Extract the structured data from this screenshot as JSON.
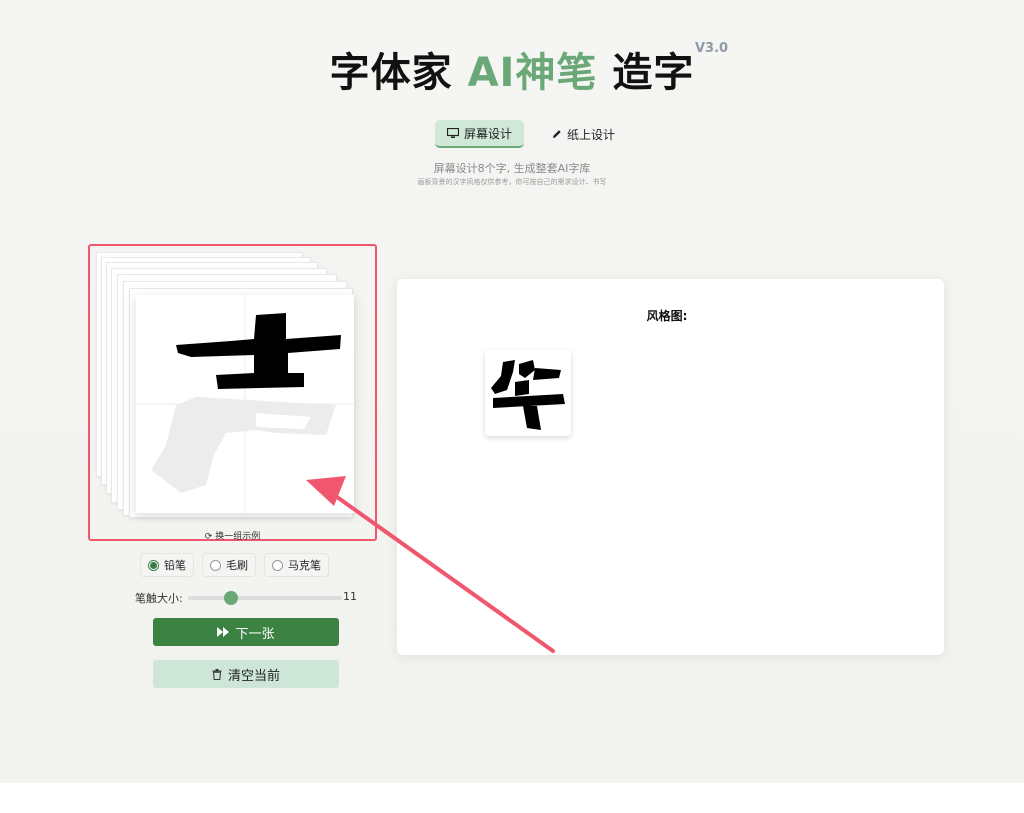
{
  "header": {
    "title_prefix": "字体家",
    "title_accent": "AI神笔",
    "title_suffix": "造字",
    "version": "V3.0"
  },
  "modes": [
    {
      "label": "屏幕设计",
      "icon": "monitor-icon",
      "active": true
    },
    {
      "label": "纸上设计",
      "icon": "pencil-icon",
      "active": false
    }
  ],
  "subtitle": "屏幕设计8个字, 生成整套AI字库",
  "subnote": "画板背景的汉字风格仅供参考，你可按自己的需求设计、书写",
  "canvas": {
    "change_examples_label": "换一组示例",
    "brushes": [
      {
        "label": "铅笔",
        "selected": true
      },
      {
        "label": "毛刷",
        "selected": false
      },
      {
        "label": "马克笔",
        "selected": false
      }
    ],
    "size_label": "笔触大小:",
    "size_value": "11",
    "size_fraction": 0.28
  },
  "actions": {
    "next_label": "下一张",
    "clear_label": "清空当前"
  },
  "style_panel": {
    "title": "风格图:"
  },
  "colors": {
    "accent_green": "#6aa877",
    "primary_button": "#3b8243",
    "secondary_button": "#cde6d8",
    "highlight_red": "#f0566e"
  }
}
